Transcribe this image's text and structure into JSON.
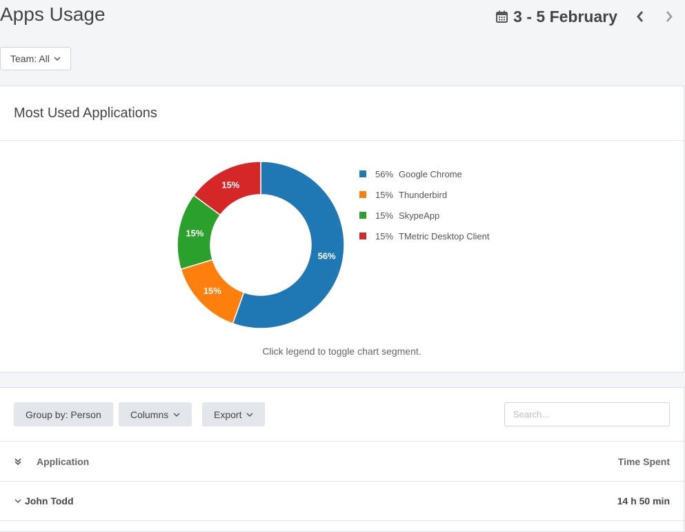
{
  "header": {
    "title": "Apps Usage",
    "date_range": "3 - 5 February",
    "icons": {
      "calendar": "calendar-icon",
      "prev": "chevron-left-icon",
      "next": "chevron-right-icon"
    }
  },
  "filters": {
    "team_label": "Team: All"
  },
  "chart_card": {
    "title": "Most Used Applications",
    "hint": "Click legend to toggle chart segment."
  },
  "chart_data": {
    "type": "pie",
    "title": "",
    "categories": [
      "Google Chrome",
      "Thunderbird",
      "SkypeApp",
      "TMetric Desktop Client"
    ],
    "values": [
      56,
      15,
      15,
      15
    ],
    "labels": [
      "56%",
      "15%",
      "15%",
      "15%"
    ],
    "colors": [
      "#1f77b4",
      "#ff7f0e",
      "#2ca02c",
      "#d62728"
    ],
    "donut": true,
    "legend_position": "right"
  },
  "table_card": {
    "buttons": {
      "group_by": "Group by: Person",
      "columns": "Columns",
      "export": "Export"
    },
    "search_placeholder": "Search...",
    "columns": {
      "application": "Application",
      "time_spent": "Time Spent"
    },
    "rows": [
      {
        "name": "John Todd",
        "time": "14 h 50 min"
      }
    ]
  }
}
